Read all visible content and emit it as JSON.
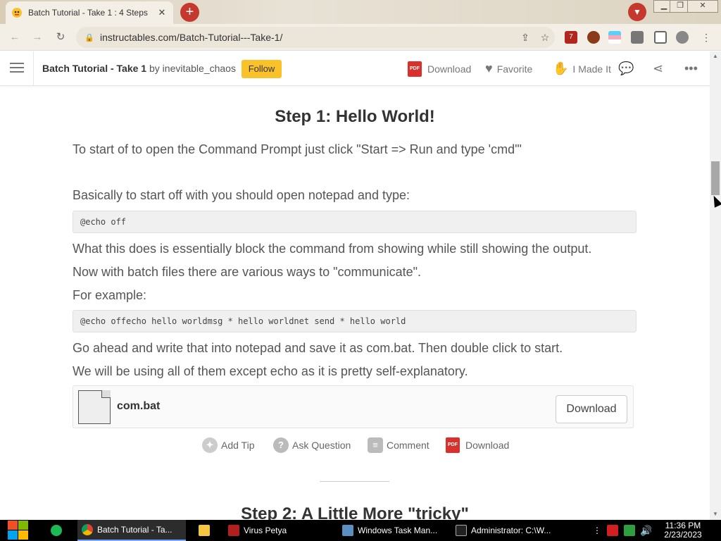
{
  "browser": {
    "tab_title": "Batch Tutorial - Take 1 : 4 Steps",
    "url": "instructables.com/Batch-Tutorial---Take-1/",
    "new_tab_symbol": "+",
    "tab_close_symbol": "✕",
    "ext_badge": "7"
  },
  "header": {
    "title": "Batch Tutorial - Take 1",
    "by_text": "by inevitable_chaos",
    "follow_label": "Follow",
    "download_label": "Download",
    "favorite_label": "Favorite",
    "made_it_label": "I Made It"
  },
  "step1": {
    "title": "Step 1: Hello World!",
    "p1": "To start of to open the Command Prompt just click \"Start => Run and type 'cmd'\"",
    "p2": "Basically to start off with you should open notepad and type:",
    "code1": "@echo off",
    "p3": "What this does is essentially block the command from showing while still showing the output.",
    "p4": "Now with batch files there are various ways to \"communicate\".",
    "p5": "For example:",
    "code2": "@echo offecho hello worldmsg * hello worldnet send * hello world",
    "p6": "Go ahead and write that into notepad and save it as com.bat. Then double click to start.",
    "p7": "We will be using all of them except echo as it is pretty self-explanatory.",
    "file_name": "com.bat",
    "file_download": "Download"
  },
  "actions": {
    "add_tip": "Add Tip",
    "ask_question": "Ask Question",
    "comment": "Comment",
    "download": "Download"
  },
  "step2": {
    "title": "Step 2: A Little More \"tricky\""
  },
  "taskbar": {
    "items": [
      "Batch Tutorial - Ta...",
      "Virus Petya",
      "Windows Task Man...",
      "Administrator: C:\\W..."
    ],
    "time": "11:36 PM",
    "date": "2/23/2023"
  },
  "colors": {
    "accent": "#fac129",
    "pdf_red": "#d9302c",
    "chrome_red": "#c4382d"
  }
}
